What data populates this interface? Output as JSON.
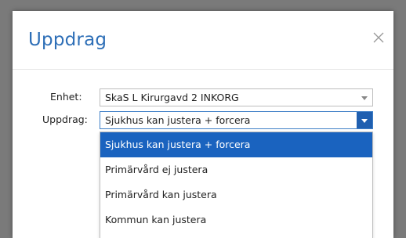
{
  "dialog": {
    "title": "Uppdrag",
    "close_icon": "close-icon"
  },
  "form": {
    "enhet_label": "Enhet:",
    "enhet_value": "SkaS L Kirurgavd 2 INKORG",
    "uppdrag_label": "Uppdrag:",
    "uppdrag_value": "Sjukhus kan justera + forcera"
  },
  "dropdown": {
    "options": [
      {
        "label": "Sjukhus kan justera + forcera",
        "selected": true
      },
      {
        "label": "Primärvård ej justera",
        "selected": false
      },
      {
        "label": "Primärvård kan justera",
        "selected": false
      },
      {
        "label": "Kommun kan justera",
        "selected": false
      }
    ]
  },
  "colors": {
    "title": "#2e6fb7",
    "selection": "#1a63bf",
    "overlay": "#7a7a7a"
  }
}
